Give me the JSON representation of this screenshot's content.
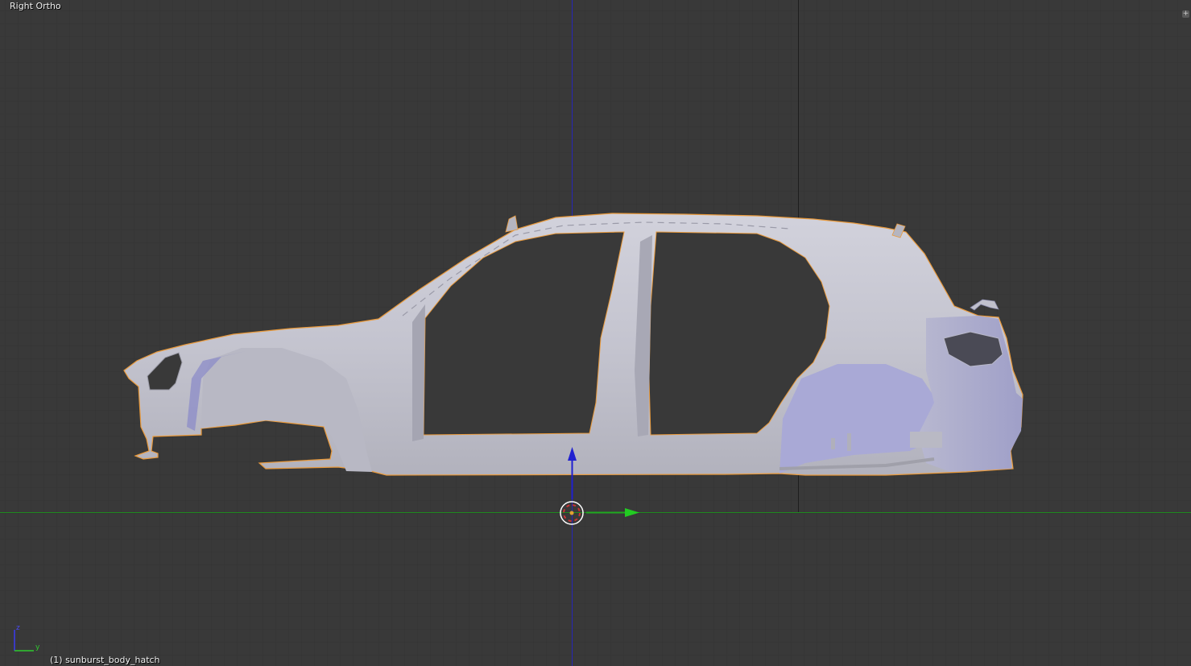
{
  "viewport": {
    "view_name": "Right Ortho",
    "active_object": "(1) sunburst_body_hatch",
    "split_icon": "plus-icon"
  },
  "mini_axes": {
    "z_label": "z",
    "y_label": "y"
  },
  "colors": {
    "background": "#393939",
    "grid": "#333333",
    "y_axis": "#1a8a1a",
    "z_axis": "#2222b0",
    "selection_outline": "#e99a3c",
    "body_fill": "#c6c6d2"
  }
}
